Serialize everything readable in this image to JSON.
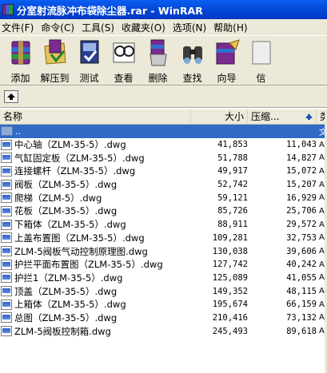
{
  "window": {
    "title": "分室射流脉冲布袋除尘器.rar - WinRAR"
  },
  "menu": [
    "文件(F)",
    "命令(C)",
    "工具(S)",
    "收藏夹(O)",
    "选项(N)",
    "帮助(H)"
  ],
  "toolbar": [
    {
      "label": "添加",
      "icon": "add-archive-icon"
    },
    {
      "label": "解压到",
      "icon": "extract-to-icon"
    },
    {
      "label": "测试",
      "icon": "test-icon"
    },
    {
      "label": "查看",
      "icon": "view-icon"
    },
    {
      "label": "删除",
      "icon": "delete-icon"
    },
    {
      "label": "查找",
      "icon": "find-icon"
    },
    {
      "label": "向导",
      "icon": "wizard-icon"
    },
    {
      "label": "信",
      "icon": "info-icon"
    }
  ],
  "columns": {
    "name": "名称",
    "size": "大小",
    "packed": "压缩...",
    "type": "类"
  },
  "parent_row": {
    "name": "..",
    "type": "文"
  },
  "files": [
    {
      "name": "中心轴（ZLM-35-5）.dwg",
      "size": "41,853",
      "packed": "11,043",
      "type": "Au"
    },
    {
      "name": "气缸固定板（ZLM-35-5）.dwg",
      "size": "51,788",
      "packed": "14,827",
      "type": "Au"
    },
    {
      "name": "连接螺杆（ZLM-35-5）.dwg",
      "size": "49,917",
      "packed": "15,072",
      "type": "Au"
    },
    {
      "name": "阀板（ZLM-35-5）.dwg",
      "size": "52,742",
      "packed": "15,207",
      "type": "Au"
    },
    {
      "name": "爬梯（ZLM-5）.dwg",
      "size": "59,121",
      "packed": "16,929",
      "type": "Au"
    },
    {
      "name": "花板（ZLM-35-5）.dwg",
      "size": "85,726",
      "packed": "25,706",
      "type": "Au"
    },
    {
      "name": "下箱体（ZLM-35-5）.dwg",
      "size": "88,911",
      "packed": "29,572",
      "type": "Au"
    },
    {
      "name": "上盖布置图（ZLM-35-5）.dwg",
      "size": "109,281",
      "packed": "32,753",
      "type": "Au"
    },
    {
      "name": "ZLM-5阀板气动控制原理图.dwg",
      "size": "130,038",
      "packed": "39,606",
      "type": "Au"
    },
    {
      "name": "护拦平面布置图（ZLM-35-5）.dwg",
      "size": "127,742",
      "packed": "40,242",
      "type": "Au"
    },
    {
      "name": "护拦1（ZLM-35-5）.dwg",
      "size": "125,089",
      "packed": "41,055",
      "type": "Au"
    },
    {
      "name": "顶盖（ZLM-35-5）.dwg",
      "size": "149,352",
      "packed": "48,115",
      "type": "Au"
    },
    {
      "name": "上箱体（ZLM-35-5）.dwg",
      "size": "195,674",
      "packed": "66,159",
      "type": "Au"
    },
    {
      "name": "总图（ZLM-35-5）.dwg",
      "size": "210,416",
      "packed": "73,132",
      "type": "Au"
    },
    {
      "name": "ZLM-5阀板控制箱.dwg",
      "size": "245,493",
      "packed": "89,618",
      "type": "Au"
    }
  ],
  "colors": {
    "title_bar": "#0348d6",
    "selection": "#316ac5",
    "chrome": "#ece9d8"
  }
}
